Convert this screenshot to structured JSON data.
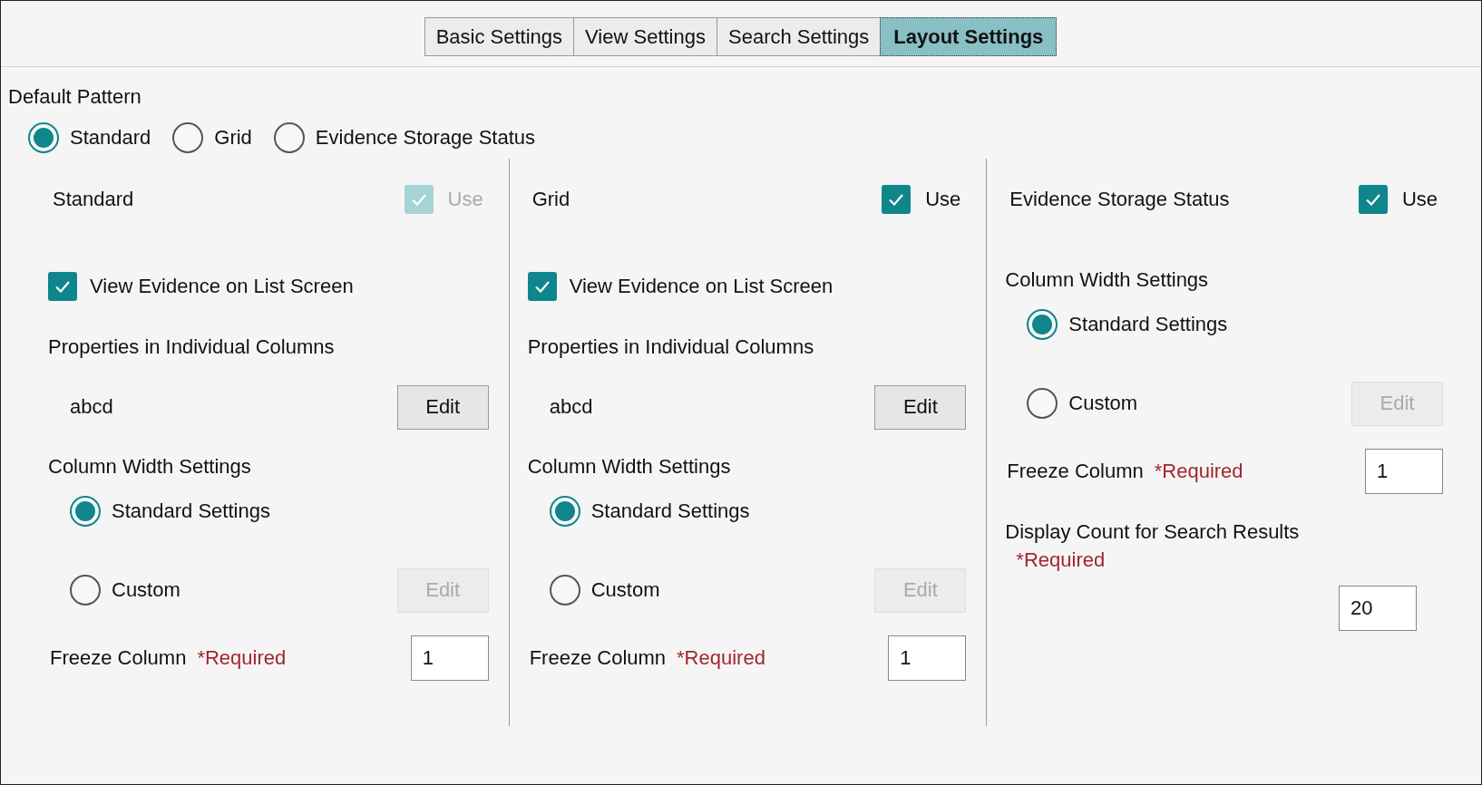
{
  "tabs": [
    {
      "label": "Basic Settings",
      "selected": false
    },
    {
      "label": "View Settings",
      "selected": false
    },
    {
      "label": "Search Settings",
      "selected": false
    },
    {
      "label": "Layout Settings",
      "selected": true
    }
  ],
  "default_pattern": {
    "label": "Default Pattern",
    "options": [
      {
        "label": "Standard",
        "selected": true
      },
      {
        "label": "Grid",
        "selected": false
      },
      {
        "label": "Evidence Storage Status",
        "selected": false
      }
    ]
  },
  "panels": [
    {
      "title": "Standard",
      "use": {
        "label": "Use",
        "checked": true,
        "disabled": true
      },
      "view_evidence": {
        "label": "View Evidence on List Screen",
        "checked": true
      },
      "properties": {
        "label": "Properties in Individual Columns",
        "value": "abcd",
        "edit_button": {
          "label": "Edit",
          "disabled": false
        }
      },
      "column_width": {
        "label": "Column Width Settings",
        "options": [
          {
            "label": "Standard Settings",
            "selected": true
          },
          {
            "label": "Custom",
            "selected": false,
            "edit_button": {
              "label": "Edit",
              "disabled": true
            }
          }
        ]
      },
      "freeze_column": {
        "label": "Freeze Column",
        "required": "*Required",
        "value": "1"
      }
    },
    {
      "title": "Grid",
      "use": {
        "label": "Use",
        "checked": true,
        "disabled": false
      },
      "view_evidence": {
        "label": "View Evidence on List Screen",
        "checked": true
      },
      "properties": {
        "label": "Properties in Individual Columns",
        "value": "abcd",
        "edit_button": {
          "label": "Edit",
          "disabled": false
        }
      },
      "column_width": {
        "label": "Column Width Settings",
        "options": [
          {
            "label": "Standard Settings",
            "selected": true
          },
          {
            "label": "Custom",
            "selected": false,
            "edit_button": {
              "label": "Edit",
              "disabled": true
            }
          }
        ]
      },
      "freeze_column": {
        "label": "Freeze Column",
        "required": "*Required",
        "value": "1"
      }
    },
    {
      "title": "Evidence Storage Status",
      "use": {
        "label": "Use",
        "checked": true,
        "disabled": false
      },
      "column_width": {
        "label": "Column Width Settings",
        "options": [
          {
            "label": "Standard Settings",
            "selected": true
          },
          {
            "label": "Custom",
            "selected": false,
            "edit_button": {
              "label": "Edit",
              "disabled": true
            }
          }
        ]
      },
      "freeze_column": {
        "label": "Freeze Column",
        "required": "*Required",
        "value": "1"
      },
      "display_count": {
        "label": "Display Count for Search Results",
        "required": "*Required",
        "value": "20"
      }
    }
  ]
}
